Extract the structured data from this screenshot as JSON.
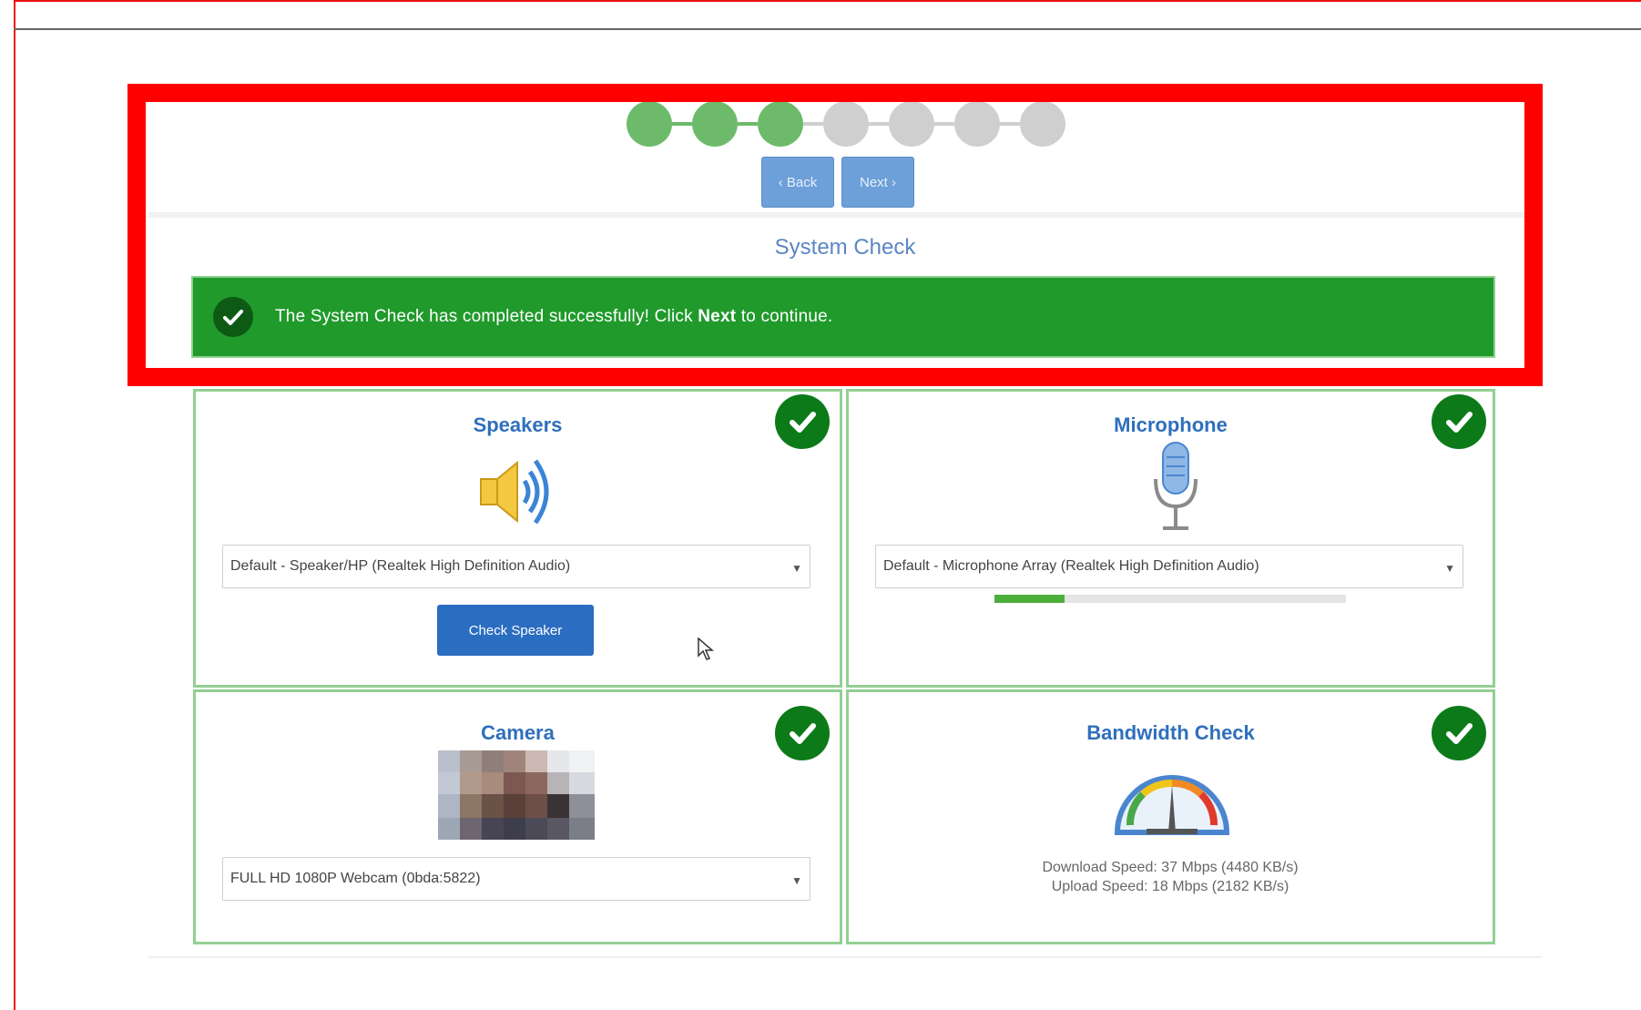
{
  "stepper": {
    "steps": [
      {
        "state": "done"
      },
      {
        "state": "done"
      },
      {
        "state": "done"
      },
      {
        "state": "pending"
      },
      {
        "state": "pending"
      },
      {
        "state": "pending"
      },
      {
        "state": "pending"
      }
    ],
    "back_label": "‹ Back",
    "next_label": "Next ›"
  },
  "title": "System Check",
  "banner": {
    "text_before": "The System Check has completed successfully! Click ",
    "text_bold": "Next",
    "text_after": " to continue."
  },
  "speakers": {
    "title": "Speakers",
    "device": "Default - Speaker/HP (Realtek High Definition Audio)",
    "button_label": "Check Speaker"
  },
  "microphone": {
    "title": "Microphone",
    "device": "Default - Microphone Array (Realtek High Definition Audio)",
    "level_fraction": 0.2
  },
  "camera": {
    "title": "Camera",
    "device": "FULL HD 1080P Webcam (0bda:5822)"
  },
  "bandwidth": {
    "title": "Bandwidth Check",
    "download": "Download Speed: 37 Mbps (4480 KB/s)",
    "upload": "Upload Speed: 18 Mbps (2182 KB/s)"
  },
  "colors": {
    "success": "#1f9a2b",
    "accent_blue": "#2f6fbc",
    "step_done": "#6dbb6a",
    "step_pending": "#cfcfcf",
    "highlight": "#ff0000"
  }
}
